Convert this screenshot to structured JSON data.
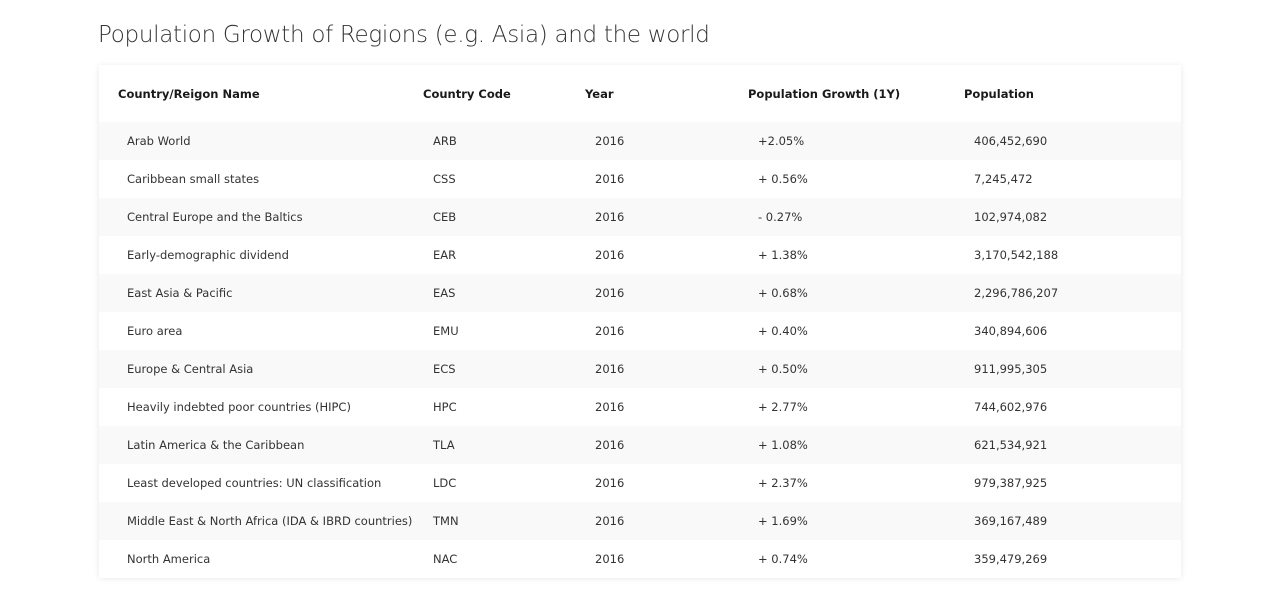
{
  "page": {
    "title": "Population Growth of Regions (e.g. Asia) and the world"
  },
  "colors": {
    "positive": "#5cb85c",
    "negative": "#d9363e"
  },
  "table": {
    "headers": {
      "name": "Country/Reigon Name",
      "code": "Country Code",
      "year": "Year",
      "growth": "Population Growth (1Y)",
      "population": "Population"
    },
    "rows": [
      {
        "name": "Arab World",
        "code": "ARB",
        "year": "2016",
        "growth": "+2.05%",
        "trend": "pos",
        "population": "406,452,690"
      },
      {
        "name": "Caribbean small states",
        "code": "CSS",
        "year": "2016",
        "growth": "+ 0.56%",
        "trend": "pos",
        "population": "7,245,472"
      },
      {
        "name": "Central Europe and the Baltics",
        "code": "CEB",
        "year": "2016",
        "growth": "- 0.27%",
        "trend": "neg",
        "population": "102,974,082"
      },
      {
        "name": "Early-demographic dividend",
        "code": "EAR",
        "year": "2016",
        "growth": "+ 1.38%",
        "trend": "pos",
        "population": "3,170,542,188"
      },
      {
        "name": "East Asia & Pacific",
        "code": "EAS",
        "year": "2016",
        "growth": "+ 0.68%",
        "trend": "pos",
        "population": "2,296,786,207"
      },
      {
        "name": "Euro area",
        "code": "EMU",
        "year": "2016",
        "growth": "+ 0.40%",
        "trend": "pos",
        "population": "340,894,606"
      },
      {
        "name": "Europe & Central Asia",
        "code": "ECS",
        "year": "2016",
        "growth": "+ 0.50%",
        "trend": "pos",
        "population": "911,995,305"
      },
      {
        "name": "Heavily indebted poor countries (HIPC)",
        "code": "HPC",
        "year": "2016",
        "growth": "+ 2.77%",
        "trend": "pos",
        "population": "744,602,976"
      },
      {
        "name": "Latin America & the Caribbean",
        "code": "TLA",
        "year": "2016",
        "growth": "+ 1.08%",
        "trend": "pos",
        "population": "621,534,921"
      },
      {
        "name": "Least developed countries: UN classification",
        "code": "LDC",
        "year": "2016",
        "growth": "+ 2.37%",
        "trend": "pos",
        "population": "979,387,925"
      },
      {
        "name": "Middle East & North Africa (IDA & IBRD countries)",
        "code": "TMN",
        "year": "2016",
        "growth": "+ 1.69%",
        "trend": "pos",
        "population": "369,167,489"
      },
      {
        "name": "North America",
        "code": "NAC",
        "year": "2016",
        "growth": "+ 0.74%",
        "trend": "pos",
        "population": "359,479,269"
      }
    ]
  }
}
